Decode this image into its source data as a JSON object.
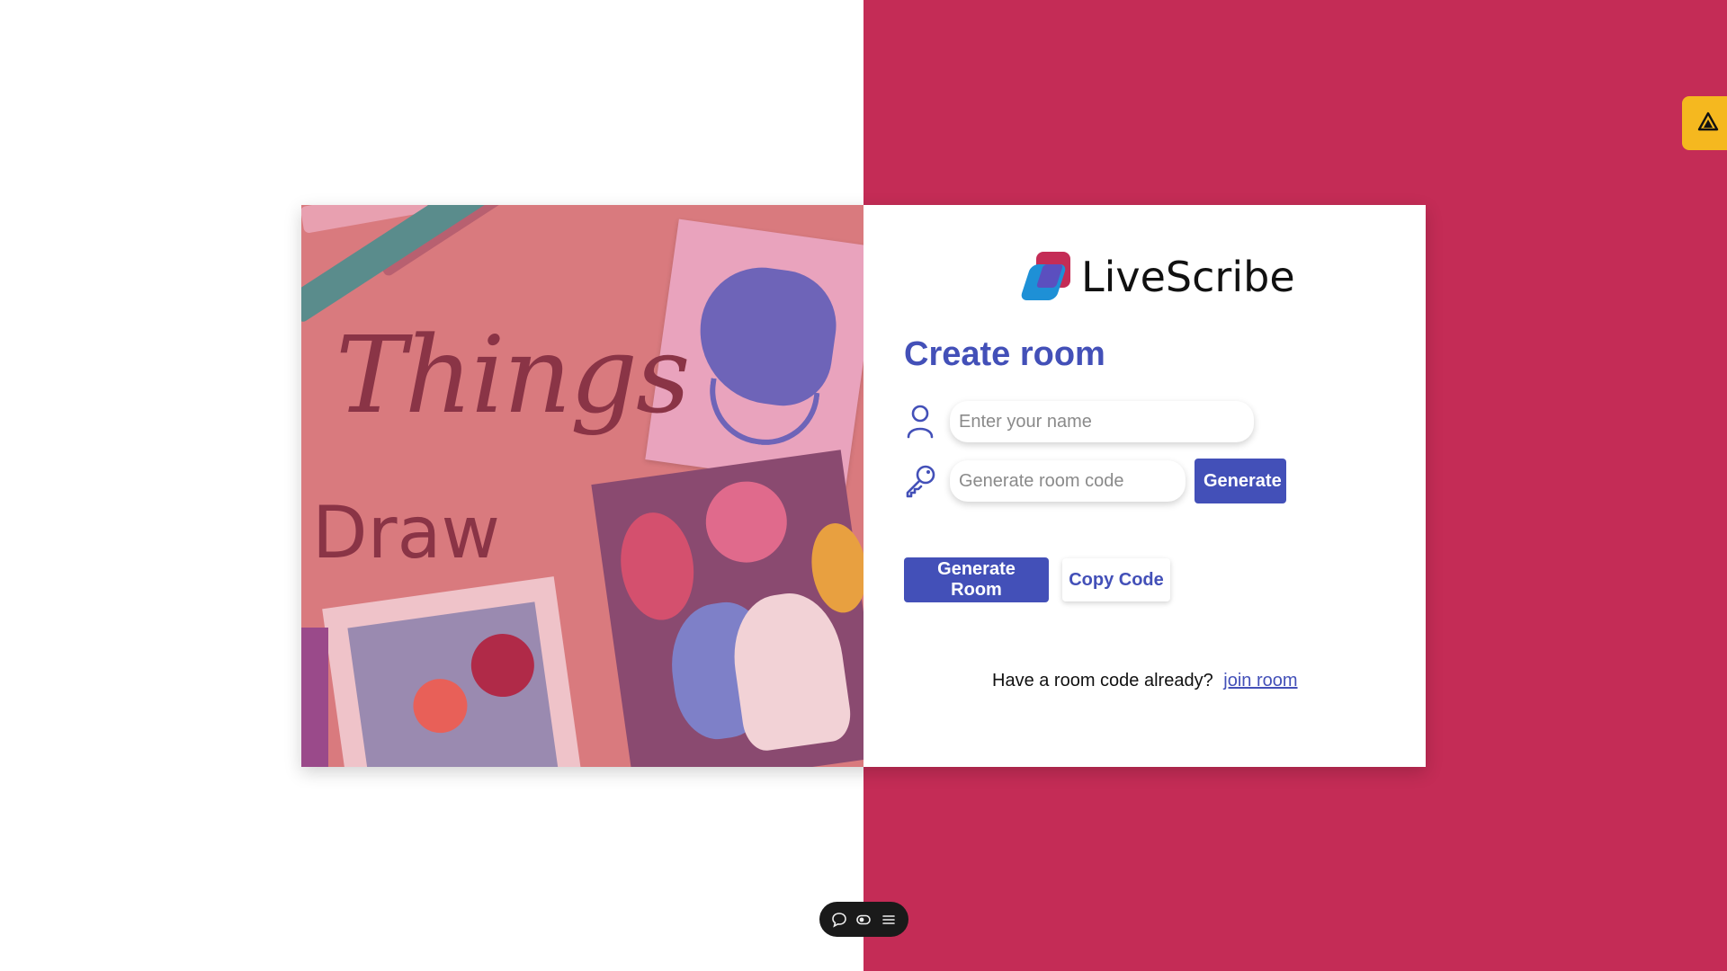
{
  "artwork": {
    "title_word1": "Things",
    "title_word2": "Draw"
  },
  "brand": {
    "name": "LiveScribe",
    "colors": {
      "red": "#c42c56",
      "blue": "#1e90d6",
      "purple": "#5b4fbf"
    }
  },
  "form": {
    "heading": "Create room",
    "name_placeholder": "Enter your name",
    "code_placeholder": "Generate room code",
    "generate_label": "Generate",
    "generate_room_label": "Generate Room",
    "copy_code_label": "Copy Code"
  },
  "join": {
    "prompt": "Have a room code already?",
    "link_label": "join room"
  },
  "toolbar": {
    "icons": [
      "chat-icon",
      "toggle-icon",
      "menu-icon"
    ]
  },
  "theme": {
    "accent": "#4350b8",
    "background_right": "#c42c56",
    "side_tab": "#f5b81f"
  }
}
